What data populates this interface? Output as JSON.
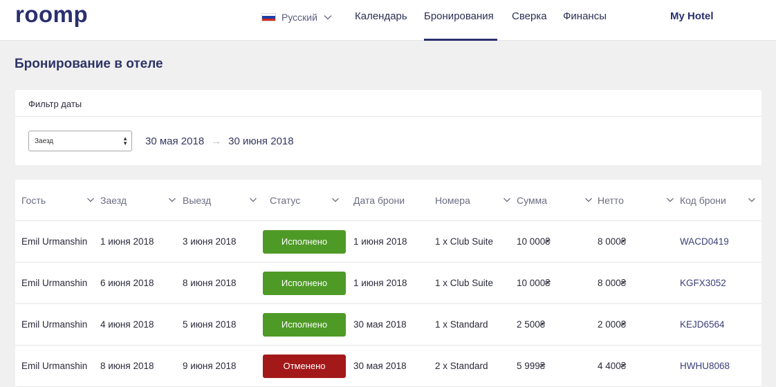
{
  "app": {
    "logo": "roomp",
    "hotel_name": "My Hotel"
  },
  "language": {
    "label": "Русский",
    "flag_colors": [
      "#ffffff",
      "#1c3fa8",
      "#d52b1e"
    ]
  },
  "nav": {
    "items": [
      {
        "label": "Календарь",
        "active": false
      },
      {
        "label": "Бронирования",
        "active": true
      },
      {
        "label": "Сверка",
        "active": false
      },
      {
        "label": "Финансы",
        "active": false
      }
    ]
  },
  "page": {
    "title": "Бронирование в отеле"
  },
  "filter": {
    "heading": "Фильтр даты",
    "select_value": "Заезд",
    "date_from": "30 мая 2018",
    "date_to": "30 июня 2018",
    "arrow": "→"
  },
  "table": {
    "columns": [
      "Гость",
      "Заезд",
      "Выезд",
      "Статус",
      "Дата брони",
      "Номера",
      "Сумма",
      "Нетто",
      "Код брони"
    ],
    "rows": [
      {
        "guest": "Emil Urmanshin",
        "checkin": "1 июня 2018",
        "checkout": "3 июня 2018",
        "status": "Исполнено",
        "status_type": "done",
        "booked": "1 июня 2018",
        "rooms": "1 x Club Suite",
        "sum": "10 000₴",
        "net": "8 000₴",
        "code": "WACD0419"
      },
      {
        "guest": "Emil Urmanshin",
        "checkin": "6 июня 2018",
        "checkout": "8 июня 2018",
        "status": "Исполнено",
        "status_type": "done",
        "booked": "1 июня 2018",
        "rooms": "1 x Club Suite",
        "sum": "10 000₴",
        "net": "8 000₴",
        "code": "KGFX3052"
      },
      {
        "guest": "Emil Urmanshin",
        "checkin": "4 июня 2018",
        "checkout": "5 июня 2018",
        "status": "Исполнено",
        "status_type": "done",
        "booked": "30 мая 2018",
        "rooms": "1 x Standard",
        "sum": "2 500₴",
        "net": "2 000₴",
        "code": "KEJD6564"
      },
      {
        "guest": "Emil Urmanshin",
        "checkin": "8 июня 2018",
        "checkout": "9 июня 2018",
        "status": "Отменено",
        "status_type": "cancelled",
        "booked": "30 мая 2018",
        "rooms": "2 x Standard",
        "sum": "5 999₴",
        "net": "4 400₴",
        "code": "HWHU8068"
      }
    ]
  },
  "colors": {
    "brand": "#2a2f6e",
    "status_done": "#4e9a26",
    "status_cancelled": "#a31919"
  },
  "icons": {
    "sort": "chevron-down-icon",
    "lang_dropdown": "chevron-down-icon",
    "select": "select-arrows-icon"
  }
}
